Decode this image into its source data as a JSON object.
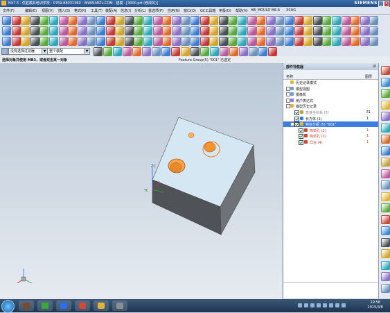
{
  "window": {
    "title": "NX7.3 · 优胜模具培训学校 · 0769-88031360 · WWW.MIZL.COM · 建模 · [3000.prt (修改的)]",
    "brand": "SIEMENS",
    "min_glyph": "_",
    "close_glyph": "x"
  },
  "menu": {
    "items": [
      "文件(F)",
      "编辑(E)",
      "视图(V)",
      "插入(S)",
      "格式(R)",
      "工具(T)",
      "装配(A)",
      "信息(I)",
      "分析(L)",
      "首选项(P)",
      "应用(N)",
      "窗口(O)",
      "GC工具箱",
      "电极(D)",
      "帮助(H)",
      "HB_MOULD M6.6",
      "XSUG"
    ]
  },
  "selection": {
    "filter_value": "没有选择过滤器",
    "scope_value": "整个装配",
    "dropdown_glyph": "▼"
  },
  "status": {
    "prompt": "选择对象并使用 MB3，或者双击某一对象",
    "message": "Feature Group(5) \"001\" 已选定"
  },
  "navigator": {
    "title": "部件导航器",
    "pin_glyph": "⊘",
    "col_name": "名称",
    "col_count": "图层",
    "nodes": [
      {
        "label": "历史记录模式",
        "count": ""
      },
      {
        "label": "模型视图",
        "count": ""
      },
      {
        "label": "摄像机",
        "count": ""
      },
      {
        "label": "用户表达式",
        "count": ""
      },
      {
        "label": "模型历史记录",
        "count": ""
      },
      {
        "label": "基准坐标系 (0)",
        "count": "61"
      },
      {
        "label": "长方体 (1)",
        "count": "1"
      },
      {
        "label": "特征分组 (5) \"001\"",
        "count": ""
      },
      {
        "label": "简单孔 (2)",
        "count": "1"
      },
      {
        "label": "简单孔 (3)",
        "count": "1"
      },
      {
        "label": "凸台 (4)",
        "count": "1"
      }
    ]
  },
  "axis": {
    "zc": "ZC",
    "yc": "YC"
  },
  "clock": {
    "time": "19:58",
    "date": "2015/4/8"
  },
  "colors": {
    "selected_row": "#3d7ee0",
    "highlight_orange": "#f07a20",
    "title_bar": "#2c5a94",
    "accent_red": "#d23a2a"
  }
}
